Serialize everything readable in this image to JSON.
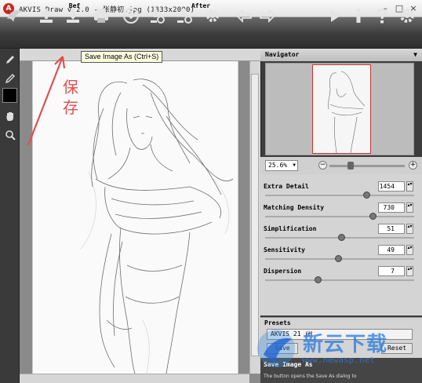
{
  "window": {
    "title": "AKVIS Draw v.2.0 - 张静初.jpg (1333x2000)",
    "logo_glyph": "A",
    "controls": [
      "–",
      "□",
      "×"
    ]
  },
  "toolbar": {
    "buttons": [
      {
        "name": "akvis-logo-icon"
      },
      {
        "name": "open-image-icon"
      },
      {
        "name": "save-image-as-icon"
      },
      {
        "name": "print-icon"
      },
      {
        "name": "share-icon"
      },
      {
        "name": "batch-processing-icon"
      },
      {
        "name": "plugin-settings-icon"
      },
      {
        "name": "preferences-gear-icon"
      },
      {
        "name": "undo-arrow-icon"
      },
      {
        "name": "redo-arrow-icon"
      },
      {
        "name": "run-icon"
      },
      {
        "name": "info-icon"
      },
      {
        "name": "help-icon"
      },
      {
        "name": "settings-gear-icon"
      }
    ],
    "tooltip": "Save Image As (Ctrl+S)"
  },
  "tabs": {
    "before": "Bef",
    "after": "After"
  },
  "annotation": {
    "text": "保存",
    "color": "#e05050"
  },
  "navigator": {
    "title": "Navigator",
    "zoom": "25.6%",
    "zoom_fraction": 0.28
  },
  "parameters": [
    {
      "label": "Extra Detail",
      "value": "1454",
      "fraction": 0.68
    },
    {
      "label": "Matching Density",
      "value": "730",
      "fraction": 0.72
    },
    {
      "label": "Simplification",
      "value": "51",
      "fraction": 0.51
    },
    {
      "label": "Sensitivity",
      "value": "49",
      "fraction": 0.49
    },
    {
      "label": "Dispersion",
      "value": "7",
      "fraction": 0.35
    }
  ],
  "presets": {
    "title": "Presets",
    "selected": "AKVIS 21 (H",
    "save_label": "Save",
    "reset_label": "Reset"
  },
  "help": {
    "title": "Save Image As",
    "text": "The button opens the Save As dialog to"
  },
  "watermark": {
    "text": "新云下载",
    "url": "www.newasp.net"
  },
  "colors": {
    "toolbar": "#3b3b3b",
    "panel": "#d4d4d4",
    "accent_red": "#e05050"
  }
}
